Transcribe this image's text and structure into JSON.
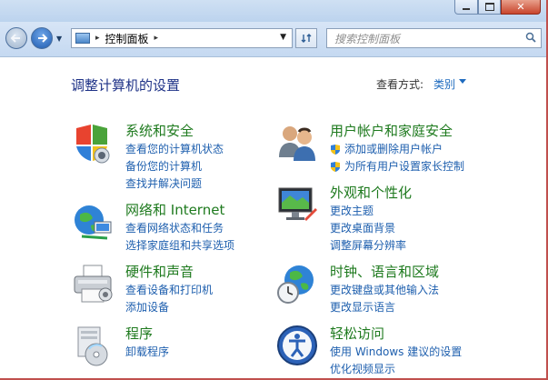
{
  "window": {
    "close_glyph": "✕"
  },
  "address": {
    "location": "控制面板",
    "separator": "▸",
    "search_placeholder": "搜索控制面板"
  },
  "header": {
    "title": "调整计算机的设置",
    "view_by_label": "查看方式:",
    "view_by_value": "类别"
  },
  "categories": [
    {
      "title": "系统和安全",
      "icon": "security-shield-icon",
      "links": [
        "查看您的计算机状态",
        "备份您的计算机",
        "查找并解决问题"
      ]
    },
    {
      "title": "网络和 Internet",
      "icon": "network-globe-icon",
      "links": [
        "查看网络状态和任务",
        "选择家庭组和共享选项"
      ]
    },
    {
      "title": "硬件和声音",
      "icon": "printer-icon",
      "links": [
        "查看设备和打印机",
        "添加设备"
      ]
    },
    {
      "title": "程序",
      "icon": "programs-disc-icon",
      "links": [
        "卸载程序"
      ]
    },
    {
      "title": "用户帐户和家庭安全",
      "icon": "users-icon",
      "links": [
        "添加或删除用户帐户",
        "为所有用户设置家长控制"
      ]
    },
    {
      "title": "外观和个性化",
      "icon": "display-monitor-icon",
      "links": [
        "更改主题",
        "更改桌面背景",
        "调整屏幕分辨率"
      ]
    },
    {
      "title": "时钟、语言和区域",
      "icon": "clock-globe-icon",
      "links": [
        "更改键盘或其他输入法",
        "更改显示语言"
      ]
    },
    {
      "title": "轻松访问",
      "icon": "ease-of-access-icon",
      "links": [
        "使用 Windows 建议的设置",
        "优化视频显示"
      ]
    }
  ]
}
